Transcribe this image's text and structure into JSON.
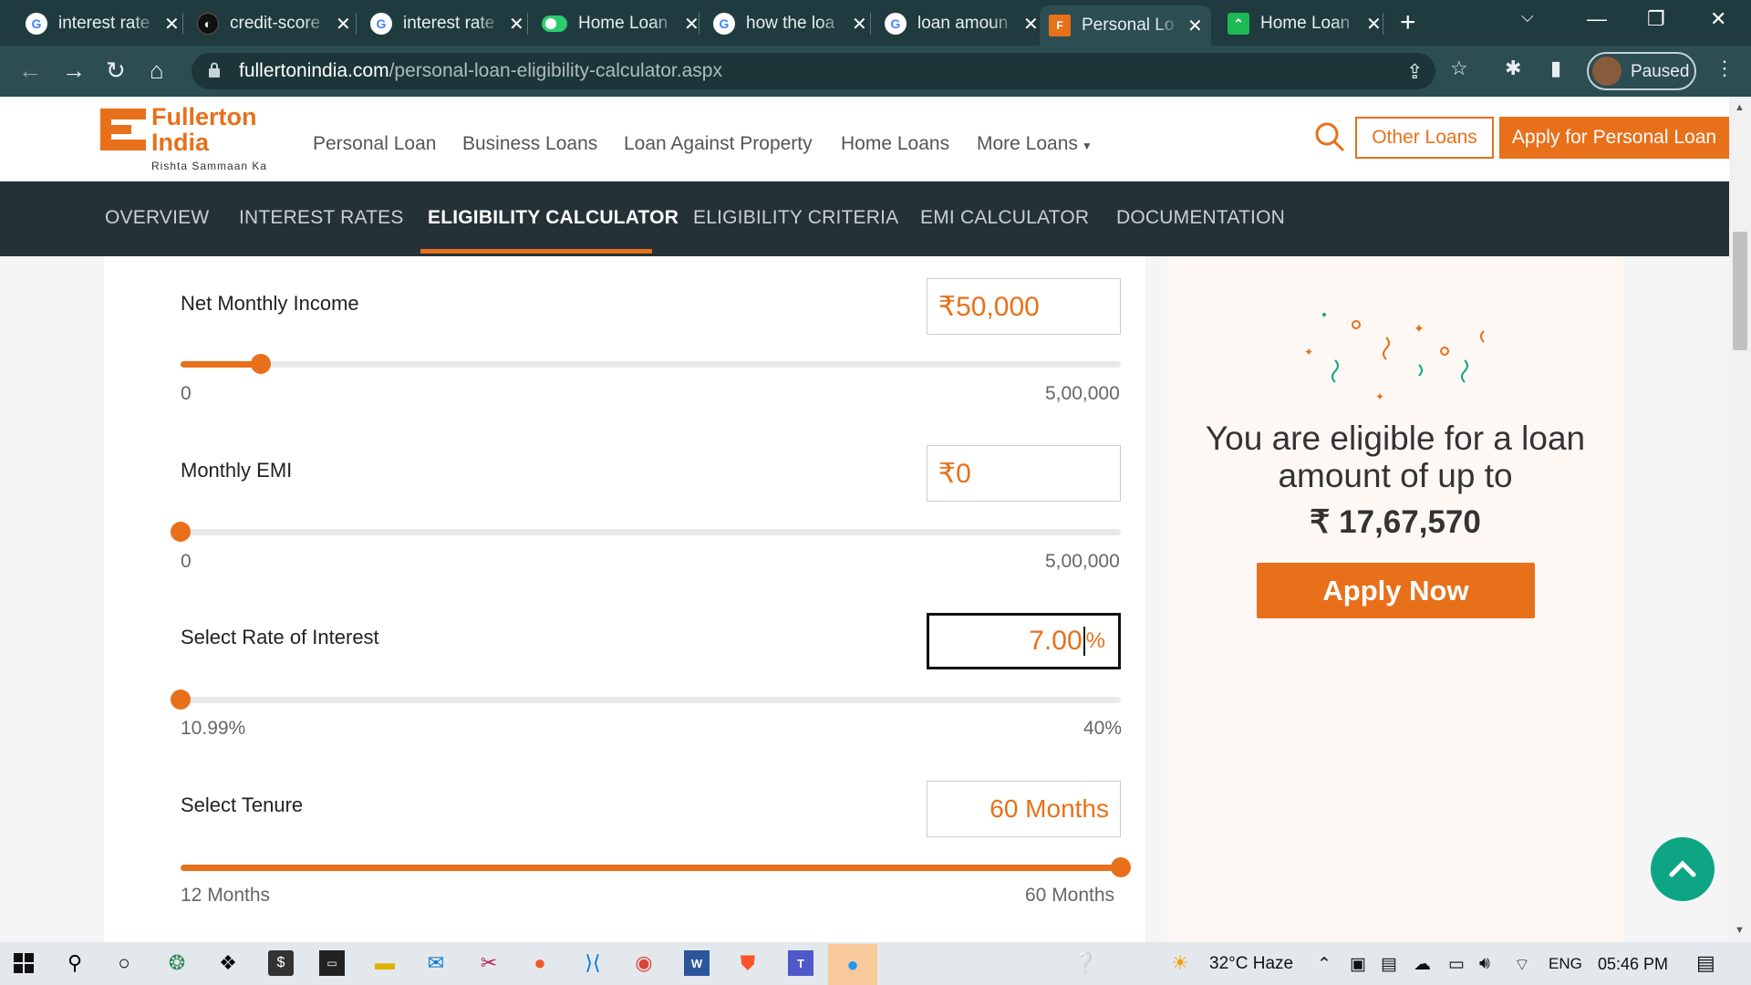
{
  "browser": {
    "tabs": [
      {
        "title": "interest rate",
        "icon": "google-icon"
      },
      {
        "title": "credit-score",
        "icon": "github-icon"
      },
      {
        "title": "interest rate",
        "icon": "google-icon"
      },
      {
        "title": "Home Loan",
        "icon": "toggle-icon"
      },
      {
        "title": "how the loa",
        "icon": "google-icon"
      },
      {
        "title": "loan amoun",
        "icon": "google-icon"
      },
      {
        "title": "Personal Lo",
        "icon": "fullerton-icon",
        "active": true
      },
      {
        "title": "Home Loan",
        "icon": "chart-icon"
      }
    ],
    "url_domain": "fullertonindia.com",
    "url_path": "/personal-loan-eligibility-calculator.aspx",
    "profile_label": "Paused"
  },
  "header": {
    "logo_name_line1": "Fullerton",
    "logo_name_line2": "India",
    "logo_tagline": "Rishta Sammaan Ka",
    "nav": [
      "Personal Loan",
      "Business Loans",
      "Loan Against Property",
      "Home Loans",
      "More Loans"
    ],
    "other_loans": "Other Loans",
    "apply_personal": "Apply for Personal Loan"
  },
  "subnav": {
    "items": [
      "OVERVIEW",
      "INTEREST RATES",
      "ELIGIBILITY CALCULATOR",
      "ELIGIBILITY CRITERIA",
      "EMI CALCULATOR",
      "DOCUMENTATION"
    ],
    "active": "ELIGIBILITY CALCULATOR"
  },
  "calculator": {
    "income": {
      "label": "Net Monthly Income",
      "value": "₹50,000",
      "min": "0",
      "max": "5,00,000",
      "fraction": 0.085
    },
    "emi": {
      "label": "Monthly EMI",
      "value": "₹0",
      "min": "0",
      "max": "5,00,000",
      "fraction": 0.0
    },
    "rate": {
      "label": "Select Rate of Interest",
      "value_before": "7.00",
      "unit": "%",
      "min": "10.99%",
      "max": "40%",
      "fraction": 0.0
    },
    "tenure": {
      "label": "Select Tenure",
      "value": "60 Months",
      "min": "12 Months",
      "max": "60 Months",
      "fraction": 1.0
    }
  },
  "result": {
    "text": "You are eligible for a loan amount of up to",
    "amount": "₹ 17,67,570",
    "apply_now": "Apply Now"
  },
  "taskbar": {
    "weather": "32°C  Haze",
    "lang": "ENG",
    "time": "05:46 PM"
  },
  "colors": {
    "accent": "#e8701a",
    "subnav_bg": "#243237",
    "scroll_top": "#0ea584"
  }
}
